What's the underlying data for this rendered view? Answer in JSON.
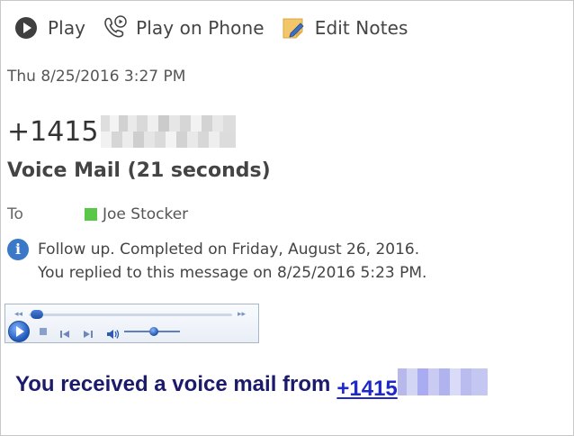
{
  "toolbar": {
    "play_label": "Play",
    "play_phone_label": "Play on Phone",
    "edit_notes_label": "Edit Notes"
  },
  "message": {
    "date": "Thu 8/25/2016 3:27 PM",
    "sender_number": "+1415",
    "subject": "Voice Mail (21 seconds)",
    "to_label": "To",
    "recipient": "Joe Stocker",
    "info_line1": "Follow up.  Completed on Friday, August 26, 2016.",
    "info_line2": "You replied to this message on 8/25/2016 5:23 PM.",
    "body_text": "You received a voice mail from",
    "body_link": "+1415"
  },
  "player": {
    "playback_fraction": 0.05,
    "volume_fraction": 0.55
  },
  "colors": {
    "presence": "#5ac748",
    "info_icon": "#3b78c8",
    "body_text": "#1c1a6b",
    "link": "#1f28c8"
  },
  "icons": {
    "play": "play-icon",
    "phone": "phone-icon",
    "notes": "edit-notes-icon",
    "info": "info-icon"
  }
}
